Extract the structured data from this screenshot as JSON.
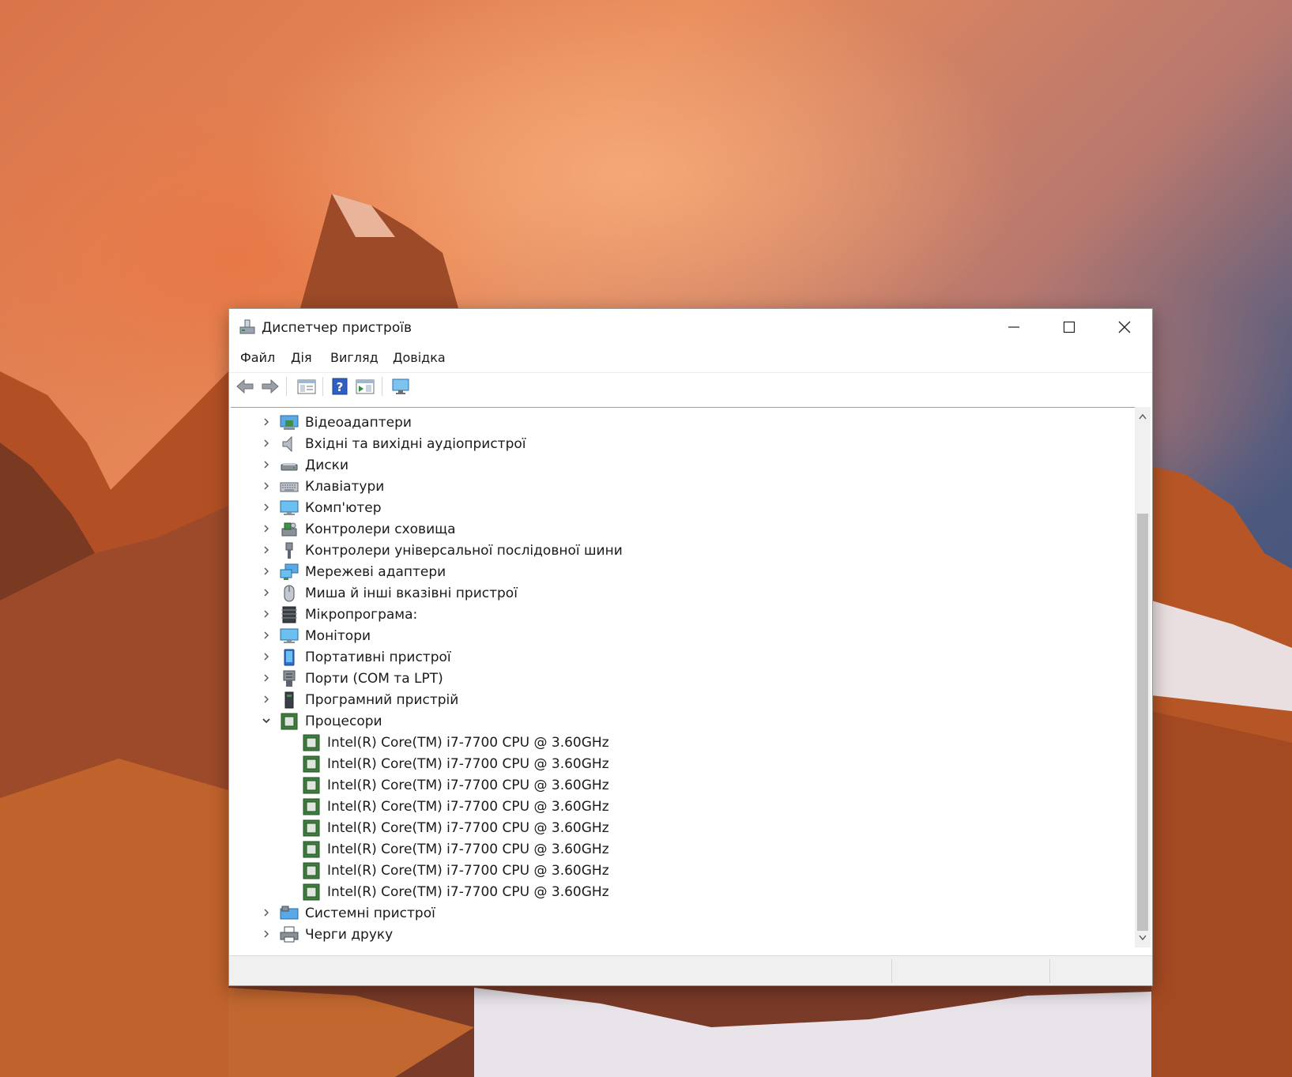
{
  "window": {
    "title": "Диспетчер пристроїв",
    "controls": {
      "minimize_icon": "minimize-icon",
      "maximize_icon": "maximize-icon",
      "close_icon": "close-icon"
    }
  },
  "menu": [
    "Файл",
    "Дія",
    "Вигляд",
    "Довідка"
  ],
  "toolbar": [
    "back-arrow-icon",
    "forward-arrow-icon",
    "properties-icon",
    "help-icon",
    "action-icon",
    "computer-monitor-icon"
  ],
  "tree": {
    "categories": [
      {
        "label": "Відеоадаптери",
        "icon": "display-adapter-icon",
        "expanded": false
      },
      {
        "label": "Вхідні та вихідні аудіопристрої",
        "icon": "speaker-icon",
        "expanded": false
      },
      {
        "label": "Диски",
        "icon": "disk-drive-icon",
        "expanded": false
      },
      {
        "label": "Клавіатури",
        "icon": "keyboard-icon",
        "expanded": false
      },
      {
        "label": "Комп'ютер",
        "icon": "computer-icon",
        "expanded": false
      },
      {
        "label": "Контролери сховища",
        "icon": "storage-controller-icon",
        "expanded": false
      },
      {
        "label": "Контролери універсальної послідовної шини",
        "icon": "usb-icon",
        "expanded": false
      },
      {
        "label": "Мережеві адаптери",
        "icon": "network-adapter-icon",
        "expanded": false
      },
      {
        "label": "Миша й інші вказівні пристрої",
        "icon": "mouse-icon",
        "expanded": false
      },
      {
        "label": "Мікропрограма:",
        "icon": "firmware-icon",
        "expanded": false
      },
      {
        "label": "Монітори",
        "icon": "monitor-icon",
        "expanded": false
      },
      {
        "label": "Портативні пристрої",
        "icon": "portable-device-icon",
        "expanded": false
      },
      {
        "label": "Порти (COM та LPT)",
        "icon": "port-icon",
        "expanded": false
      },
      {
        "label": "Програмний пристрій",
        "icon": "software-device-icon",
        "expanded": false
      },
      {
        "label": "Процесори",
        "icon": "processor-icon",
        "expanded": true,
        "children": [
          "Intel(R) Core(TM) i7-7700 CPU @ 3.60GHz",
          "Intel(R) Core(TM) i7-7700 CPU @ 3.60GHz",
          "Intel(R) Core(TM) i7-7700 CPU @ 3.60GHz",
          "Intel(R) Core(TM) i7-7700 CPU @ 3.60GHz",
          "Intel(R) Core(TM) i7-7700 CPU @ 3.60GHz",
          "Intel(R) Core(TM) i7-7700 CPU @ 3.60GHz",
          "Intel(R) Core(TM) i7-7700 CPU @ 3.60GHz",
          "Intel(R) Core(TM) i7-7700 CPU @ 3.60GHz"
        ]
      },
      {
        "label": "Системні пристрої",
        "icon": "system-device-icon",
        "expanded": false
      },
      {
        "label": "Черги друку",
        "icon": "printer-icon",
        "expanded": false
      }
    ]
  },
  "colors": {
    "accent": "#1e6fd9",
    "cpu_green": "#3f7d3a",
    "window_bg": "#ffffff",
    "chrome_bg": "#f0f0f0"
  }
}
